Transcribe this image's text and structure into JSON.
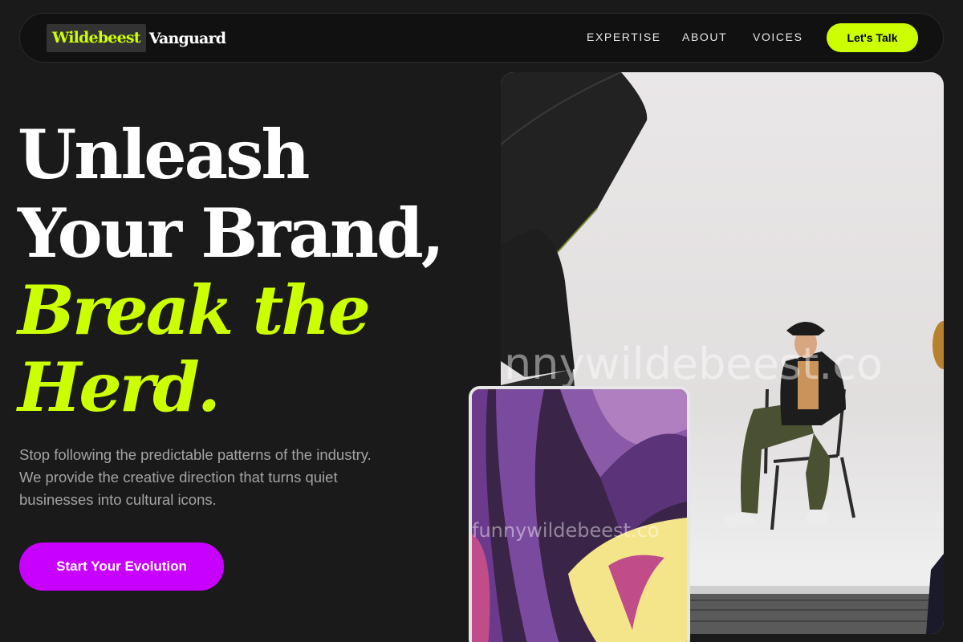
{
  "brand": {
    "word1": "Wildebeest",
    "word2": "Vanguard"
  },
  "nav": {
    "links": [
      "EXPERTISE",
      "ABOUT",
      "VOICES"
    ],
    "cta": "Let's Talk"
  },
  "hero": {
    "line1": "Unleash",
    "line2": "Your Brand,",
    "accent1": "Break the",
    "accent2": "Herd.",
    "description": "Stop following the predictable patterns of the industry. We provide the creative direction that turns quiet businesses into cultural icons.",
    "cta": "Start Your Evolution"
  },
  "images": {
    "main_watermark": "nnywildebeest.co",
    "small_watermark": "funnywildebeest.co"
  },
  "colors": {
    "background": "#1a1a1a",
    "accent_lime": "#ccff00",
    "accent_purple": "#c800ff",
    "text_muted": "#a3a3a3"
  },
  "icons": {
    "photo_main": "studio-photo-image",
    "photo_small": "abstract-art-image"
  }
}
